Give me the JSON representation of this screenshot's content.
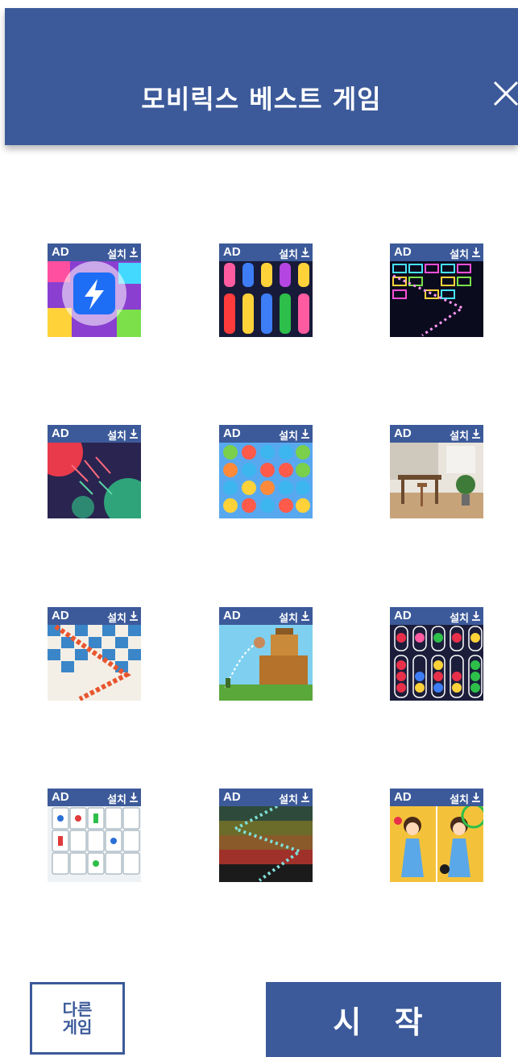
{
  "header": {
    "title": "모비릭스 베스트 게임",
    "close_icon": "close-icon"
  },
  "tile_badge": {
    "ad": "AD",
    "install": "설치",
    "install_icon": "download-icon"
  },
  "games": [
    {
      "id": "g1",
      "art": "blast-cube-art"
    },
    {
      "id": "g2",
      "art": "water-sort-art"
    },
    {
      "id": "g3",
      "art": "neon-bricks-art"
    },
    {
      "id": "g4",
      "art": "cell-wars-art"
    },
    {
      "id": "g5",
      "art": "pet-match-art"
    },
    {
      "id": "g6",
      "art": "home-design-art"
    },
    {
      "id": "g7",
      "art": "brick-breaker-art"
    },
    {
      "id": "g8",
      "art": "castle-shooter-art"
    },
    {
      "id": "g9",
      "art": "ball-sort-art"
    },
    {
      "id": "g10",
      "art": "mahjong-art"
    },
    {
      "id": "g11",
      "art": "ball-bounce-art"
    },
    {
      "id": "g12",
      "art": "find-difference-art"
    }
  ],
  "buttons": {
    "other_games": "다른 게임",
    "start": "시 작"
  },
  "colors": {
    "accent": "#3c5a9a",
    "background": "#ffffff"
  }
}
